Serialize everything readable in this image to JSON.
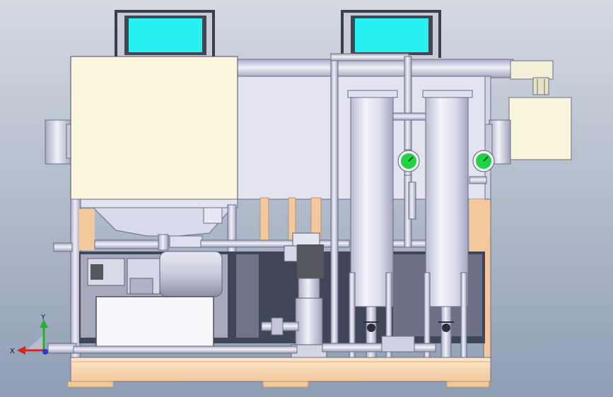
{
  "viewport": {
    "background_top": "#d4d9e2",
    "background_bottom": "#8f9eb4"
  },
  "colors": {
    "screen": "#28f0f0",
    "monitor_frame": "#3a3f4a",
    "hopper_panel": "#fbf5dd",
    "metal_light": "#e6e6f3",
    "metal_mid": "#c7c8dc",
    "metal_dark": "#8d8fa8",
    "wood_base": "#fbdcb6",
    "wood_post": "#f2c89c",
    "dark_interior": "#3e4658",
    "gauge_face": "#20d246",
    "motor_dark": "#55585e",
    "axis_x": "#dd1f1f",
    "axis_y": "#22b32a",
    "axis_z": "#2b3ad0"
  },
  "triad": {
    "x_label": "X",
    "y_label": "Y"
  },
  "parts": {
    "monitors": [
      "monitor-left",
      "monitor-right"
    ],
    "filter_columns": [
      "filter-column-left",
      "filter-column-right"
    ],
    "pressure_gauges": [
      "pressure-gauge-left",
      "pressure-gauge-right"
    ],
    "icons": [
      "coordinate-triad-icon",
      "pressure-gauge-icon",
      "valve-handle-icon"
    ]
  }
}
